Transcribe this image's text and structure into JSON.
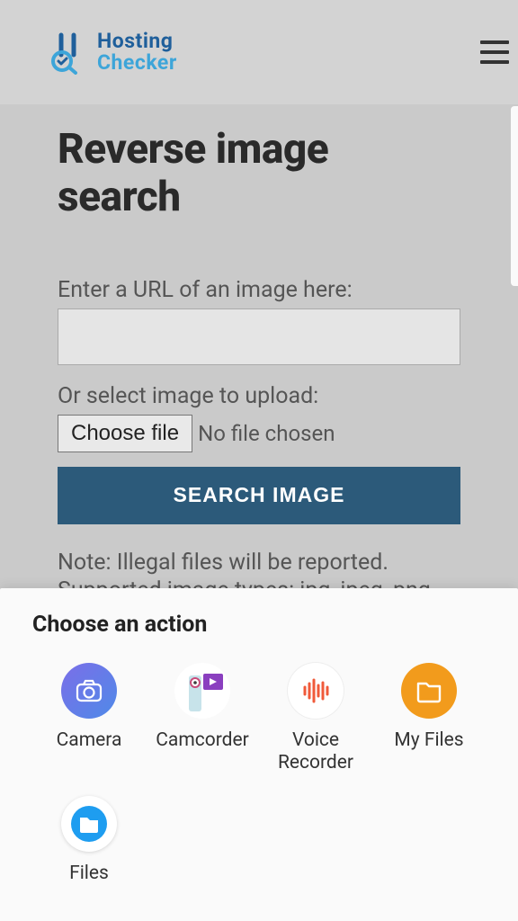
{
  "header": {
    "brand_line1": "Hosting",
    "brand_line2": "Checker"
  },
  "main": {
    "title": "Reverse image search",
    "url_label": "Enter a URL of an image here:",
    "upload_label": "Or select image to upload:",
    "choose_file_label": "Choose file",
    "no_file_text": "No file chosen",
    "search_button": "SEARCH IMAGE",
    "note": "Note: Illegal files will be reported.",
    "supported": "Supported image types: jpg, jpeg, png, gif"
  },
  "sheet": {
    "title": "Choose an action",
    "items": [
      {
        "label": "Camera"
      },
      {
        "label": "Camcorder"
      },
      {
        "label": "Voice Recorder"
      },
      {
        "label": "My Files"
      },
      {
        "label": "Files"
      }
    ]
  }
}
